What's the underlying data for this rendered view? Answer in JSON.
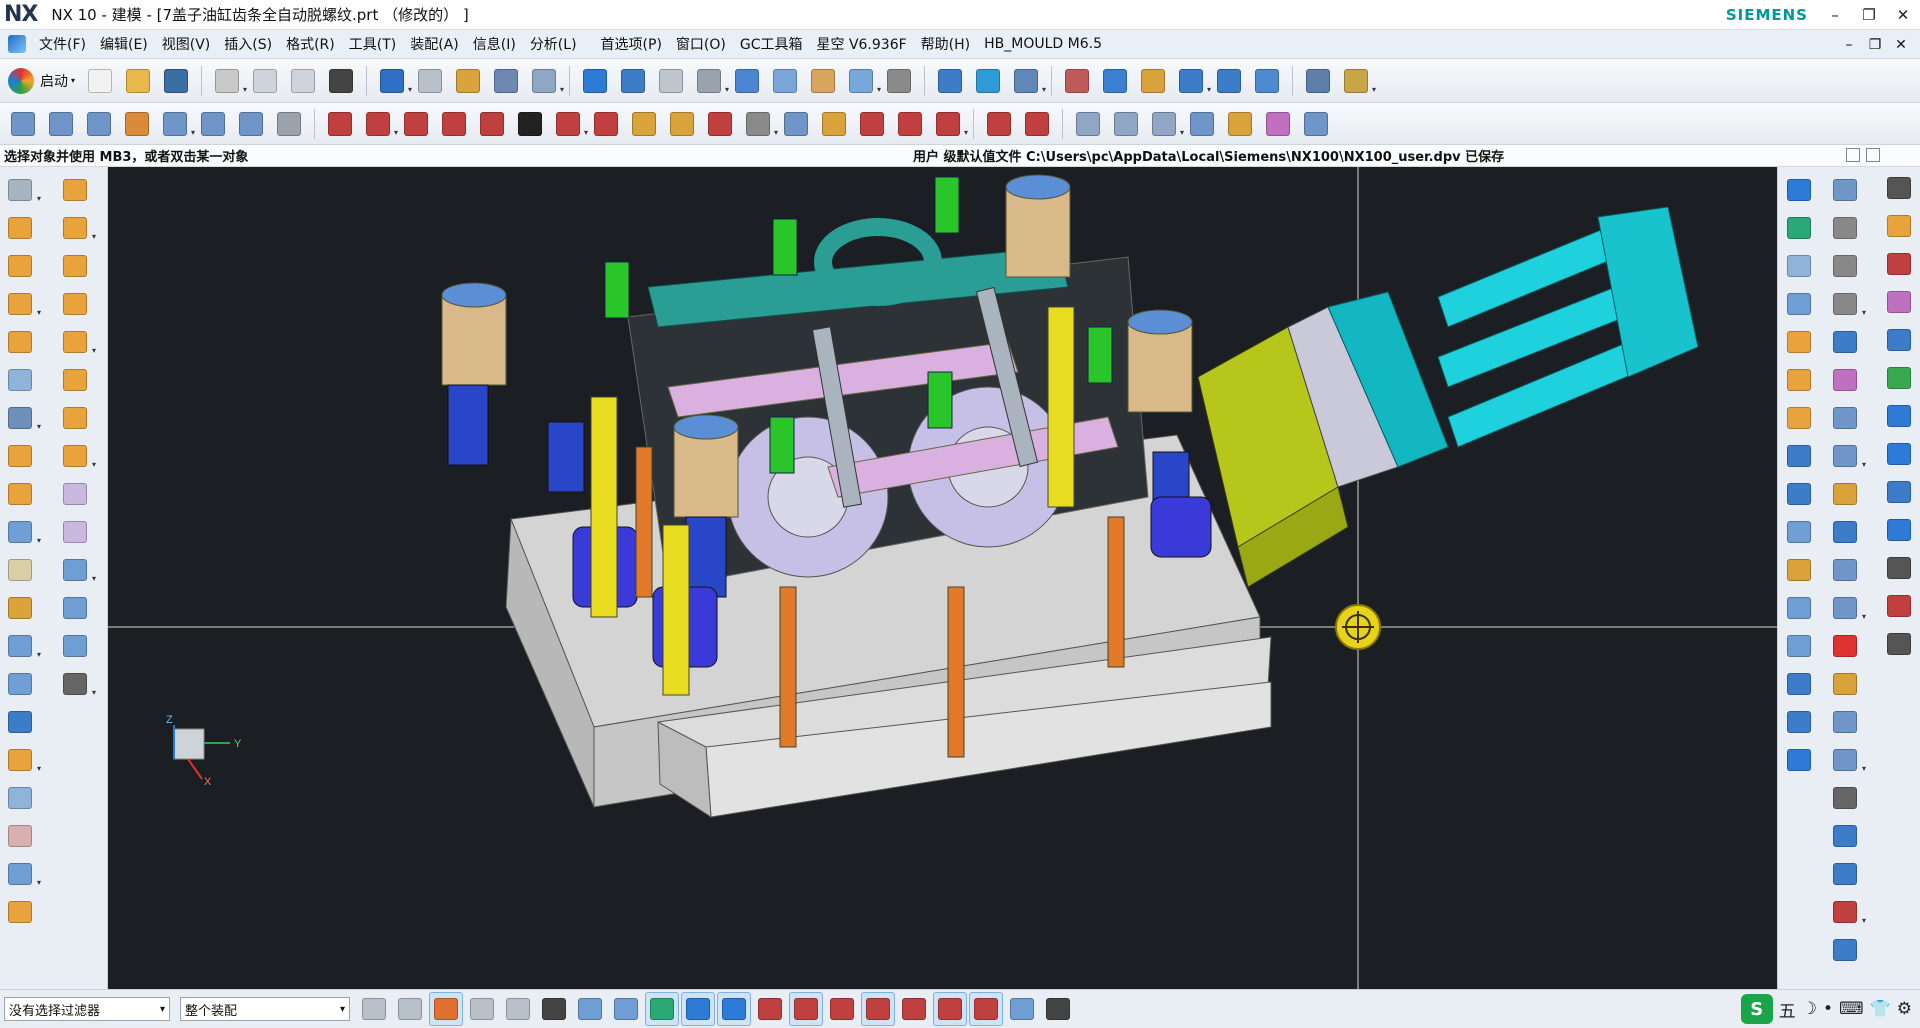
{
  "window": {
    "logo": "NX",
    "title": "NX 10 - 建模 - [7盖子油缸齿条全自动脱螺纹.prt （修改的） ]",
    "brand": "SIEMENS",
    "buttons": {
      "minimize": "–",
      "restore": "❐",
      "close": "✕"
    }
  },
  "menubar": {
    "items": [
      "文件(F)",
      "编辑(E)",
      "视图(V)",
      "插入(S)",
      "格式(R)",
      "工具(T)",
      "装配(A)",
      "信息(I)",
      "分析(L)",
      "首选项(P)",
      "窗口(O)",
      "GC工具箱",
      "星空 V6.936F",
      "帮助(H)",
      "HB_MOULD M6.5"
    ],
    "doc_buttons": {
      "minimize": "–",
      "restore": "❐",
      "close": "✕"
    }
  },
  "toolbar1": {
    "start_label": "启动",
    "icons": [
      {
        "name": "new-icon",
        "color": "#f2f2f2"
      },
      {
        "name": "open-icon",
        "color": "#e8b84a"
      },
      {
        "name": "save-icon",
        "color": "#3a6ea5"
      },
      {
        "name": "cut-icon",
        "color": "#c9c9c9"
      },
      {
        "name": "copy-icon",
        "color": "#cfd4da"
      },
      {
        "name": "paste-icon",
        "color": "#cfd4da"
      },
      {
        "name": "delete-icon",
        "color": "#444444"
      },
      {
        "name": "undo-icon",
        "color": "#2f6fc4"
      },
      {
        "name": "redo-icon",
        "color": "#b8c0ca"
      },
      {
        "name": "repeat-command-icon",
        "color": "#d9a23a"
      },
      {
        "name": "touch-mode-icon",
        "color": "#6d88b3"
      },
      {
        "name": "window-icon",
        "color": "#8fa6c5"
      },
      {
        "name": "fit-icon",
        "color": "#2d7bd6"
      },
      {
        "name": "render-style-icon",
        "color": "#3d7cc9"
      },
      {
        "name": "section-icon",
        "color": "#c0c6cd"
      },
      {
        "name": "view-orient-icon",
        "color": "#9aa3ad"
      },
      {
        "name": "shaded-icon",
        "color": "#4c86d1"
      },
      {
        "name": "wireframe-icon",
        "color": "#7aa6dc"
      },
      {
        "name": "layer-icon",
        "color": "#d8a45e"
      },
      {
        "name": "edit-section-icon",
        "color": "#78a7d9"
      },
      {
        "name": "background-icon",
        "color": "#8a8a8a"
      },
      {
        "name": "move-component-icon",
        "color": "#3d7cc9"
      },
      {
        "name": "assembly-constraint-icon",
        "color": "#2f9bd6"
      },
      {
        "name": "layer-settings-icon",
        "color": "#5f87b8"
      },
      {
        "name": "wave-linker-icon",
        "color": "#c05a5a"
      },
      {
        "name": "snap-icon",
        "color": "#3a7fd0"
      },
      {
        "name": "measure-icon",
        "color": "#d9a23a"
      },
      {
        "name": "analysis-icon",
        "color": "#3d7cc9"
      },
      {
        "name": "check-icon",
        "color": "#3d7cc9"
      },
      {
        "name": "tolerance-icon",
        "color": "#4d8ad1"
      },
      {
        "name": "scale-icon",
        "color": "#5e7fa8"
      },
      {
        "name": "ruler-icon",
        "color": "#c8a646"
      }
    ]
  },
  "toolbar2": {
    "icons": [
      {
        "name": "surface-grid-icon",
        "color": "#6f95c9"
      },
      {
        "name": "through-curves-icon",
        "color": "#6f95c9"
      },
      {
        "name": "swept-icon",
        "color": "#6f95c9"
      },
      {
        "name": "studio-surface-icon",
        "color": "#d98b3a"
      },
      {
        "name": "n-sided-icon",
        "color": "#6f95c9"
      },
      {
        "name": "ruled-icon",
        "color": "#6f95c9"
      },
      {
        "name": "offset-surface-icon",
        "color": "#6f95c9"
      },
      {
        "name": "cylinder-icon",
        "color": "#9aa3ad"
      },
      {
        "name": "line-icon",
        "color": "#c04040"
      },
      {
        "name": "line-2-icon",
        "color": "#c04040"
      },
      {
        "name": "arc-icon",
        "color": "#c04040"
      },
      {
        "name": "rectangle-icon",
        "color": "#c04040"
      },
      {
        "name": "spline-icon",
        "color": "#c04040"
      },
      {
        "name": "text-icon",
        "color": "#222222"
      },
      {
        "name": "curve-from-icon",
        "color": "#c04040"
      },
      {
        "name": "project-curve-icon",
        "color": "#c04040"
      },
      {
        "name": "intersection-curve-icon",
        "color": "#d9a23a"
      },
      {
        "name": "extract-curve-icon",
        "color": "#d9a23a"
      },
      {
        "name": "offset-curve-icon",
        "color": "#c04040"
      },
      {
        "name": "bridge-curve-icon",
        "color": "#8a8a8a"
      },
      {
        "name": "sweep-section-icon",
        "color": "#6f95c9"
      },
      {
        "name": "trim-curve-icon",
        "color": "#d9a23a"
      },
      {
        "name": "divide-curve-icon",
        "color": "#c04040"
      },
      {
        "name": "trim-corner-icon",
        "color": "#c04040"
      },
      {
        "name": "curve-length-icon",
        "color": "#c04040"
      },
      {
        "name": "join-curve-icon",
        "color": "#c04040"
      },
      {
        "name": "smooth-icon",
        "color": "#c04040"
      },
      {
        "name": "extend-sheet-icon",
        "color": "#8fa6c5"
      },
      {
        "name": "trim-sheet-icon",
        "color": "#8fa6c5"
      },
      {
        "name": "sew-icon",
        "color": "#8fa6c5"
      },
      {
        "name": "patch-icon",
        "color": "#6f95c9"
      },
      {
        "name": "flange-icon",
        "color": "#d9a23a"
      },
      {
        "name": "x-form-icon",
        "color": "#c070c0"
      },
      {
        "name": "stock-icon",
        "color": "#6f95c9"
      }
    ]
  },
  "cueline": {
    "prompt": "选择对象并使用 MB3，或者双击某一对象",
    "status": "用户 级默认值文件 C:\\Users\\pc\\AppData\\Local\\Siemens\\NX100\\NX100_user.dpv 已保存"
  },
  "left_toolbar": {
    "col1": [
      "sketch-icon",
      "extrude-icon",
      "revolve-icon",
      "hole-icon",
      "boss-icon",
      "pocket-icon",
      "pad-icon",
      "datum-plane-icon",
      "block-icon",
      "book-icon",
      "shell-icon",
      "draft-icon",
      "thicken-icon",
      "box-icon",
      "combine-icon",
      "trim-body-icon",
      "split-body-icon",
      "offset-face-icon",
      "replace-face-icon",
      "feature-icon"
    ],
    "col2": [
      "unite-icon",
      "subtract-icon",
      "intersect-icon",
      "blend-icon",
      "chamfer-icon",
      "mirror-icon",
      "pattern-icon",
      "wcs-icon",
      "move-object-icon",
      "edit-parameters-icon",
      "view-icon",
      "fit-icon-2",
      "clip-icon",
      "measure-distance-icon"
    ],
    "colors": [
      "#a6b4c2",
      "#e8a33d",
      "#e8a33d",
      "#e8a33d",
      "#e8a33d",
      "#8fb3d9",
      "#6e8fb8",
      "#e8a33d",
      "#e8a33d",
      "#6f9ed4",
      "#d9d0a8",
      "#d9a23a",
      "#6f9ed4",
      "#6f9ed4",
      "#3d7cc9",
      "#e8a33d",
      "#8fb3d9",
      "#d9b0b0",
      "#6f9ed4",
      "#e8a33d"
    ],
    "colors2": [
      "#e8a33d",
      "#e8a33d",
      "#e8a33d",
      "#e8a33d",
      "#e8a33d",
      "#e8a33d",
      "#e8a33d",
      "#e8a33d",
      "#c9b7e0",
      "#c9b7e0",
      "#6f9ed4",
      "#6f9ed4",
      "#6f9ed4",
      "#666666"
    ]
  },
  "right_toolbar": {
    "col1": [
      "pull-face-icon",
      "move-face-icon",
      "offset-region-icon",
      "draft-body-icon",
      "resize-blend-icon",
      "label-chamfer-icon",
      "replace-face-icon-2",
      "pattern-face-icon",
      "mirror-face-icon",
      "constraint-face-icon",
      "linear-dim-icon",
      "delete-face-icon",
      "copy-face-icon",
      "paste-face-icon",
      "group-face-icon",
      "name-icon"
    ],
    "col2": [
      "dimension-icon",
      "cross-section-icon",
      "part-navigator-icon",
      "assembly-navigator-icon",
      "constraint-icon",
      "component-icon",
      "explode-icon",
      "section-view-icon",
      "layer-icon-2",
      "info-icon",
      "check-clearance-icon",
      "weight-icon",
      "coordinate-icon",
      "wave-icon",
      "sequence-icon",
      "arrangement-icon",
      "rectangle-icon-2",
      "polygon-icon",
      "axis-icon",
      "point-icon",
      "circle-icon"
    ],
    "col3": [
      "settings-gear-icon",
      "assembly-load-icon",
      "reuse-library-icon",
      "hd3d-icon",
      "roles-icon",
      "palette-icon",
      "system-info-icon",
      "web-icon",
      "history-icon",
      "visualization-icon",
      "manufacturing-icon",
      "knowledge-icon",
      "help-icon"
    ],
    "colors1": [
      "#2d7bd6",
      "#2aa876",
      "#8fb3d9",
      "#6f9ed4",
      "#e8a33d",
      "#e8a33d",
      "#e8a33d",
      "#3d7cc9",
      "#3d7cc9",
      "#6f9ed4",
      "#d9a23a",
      "#6f9ed4",
      "#6f9ed4",
      "#3d7cc9",
      "#3d7cc9",
      "#2d7bd6"
    ],
    "colors2": [
      "#6f95c9",
      "#888888",
      "#888888",
      "#888888",
      "#3d7cc9",
      "#c070c0",
      "#6f95c9",
      "#6f95c9",
      "#d9a23a",
      "#3d7cc9",
      "#6f95c9",
      "#6f95c9",
      "#d33",
      "#d9a23a",
      "#6f95c9",
      "#6f95c9",
      "#666666",
      "#3d7cc9",
      "#3d7cc9",
      "#c04040",
      "#3d7cc9"
    ],
    "colors3": [
      "#555555",
      "#e8a33d",
      "#c04040",
      "#c070c0",
      "#3d7cc9",
      "#3aa84f",
      "#2d7bd6",
      "#2d7bd6",
      "#3d7cc9",
      "#2d7bd6",
      "#555555",
      "#c04040",
      "#555555"
    ]
  },
  "statusbar": {
    "filter": "没有选择过滤器",
    "scope": "整个装配",
    "icons": [
      {
        "name": "selection-priority-icon",
        "color": "#b8c0ca",
        "active": false
      },
      {
        "name": "general-selection-icon",
        "color": "#b8c0ca",
        "active": false
      },
      {
        "name": "select-filter-icon",
        "color": "#e07030",
        "active": true
      },
      {
        "name": "snap-point-icon",
        "color": "#b8c0ca",
        "active": false
      },
      {
        "name": "cursor-icon",
        "color": "#b8c0ca",
        "active": false
      },
      {
        "name": "rectangle-select-icon",
        "color": "#444444",
        "active": false
      },
      {
        "name": "select-feature-icon",
        "color": "#6f9ed4",
        "active": false
      },
      {
        "name": "select-body-icon",
        "color": "#6f9ed4",
        "active": false
      },
      {
        "name": "enable-snap-icon",
        "color": "#2aa876",
        "active": true
      },
      {
        "name": "end-point-icon",
        "color": "#2d7bd6",
        "active": true
      },
      {
        "name": "mid-point-icon",
        "color": "#2d7bd6",
        "active": true
      },
      {
        "name": "control-point-icon",
        "color": "#c04040",
        "active": false
      },
      {
        "name": "intersection-point-icon",
        "color": "#c04040",
        "active": true
      },
      {
        "name": "arc-center-icon",
        "color": "#c04040",
        "active": false
      },
      {
        "name": "quadrant-point-icon",
        "color": "#c04040",
        "active": true
      },
      {
        "name": "existing-point-icon",
        "color": "#c04040",
        "active": false
      },
      {
        "name": "point-on-curve-icon",
        "color": "#c04040",
        "active": true
      },
      {
        "name": "point-on-surface-icon",
        "color": "#c04040",
        "active": true
      },
      {
        "name": "bounded-grid-icon",
        "color": "#6f9ed4",
        "active": false
      },
      {
        "name": "grid-icon",
        "color": "#444444",
        "active": false
      }
    ],
    "ime": {
      "logo": "S",
      "items": [
        "五",
        "☽",
        "•",
        "⌨",
        "👕",
        "⚙"
      ]
    }
  },
  "viewport": {
    "background": "#1b1e22",
    "wcs_axes": {
      "x": "X",
      "y": "Y",
      "z": "Z"
    }
  }
}
